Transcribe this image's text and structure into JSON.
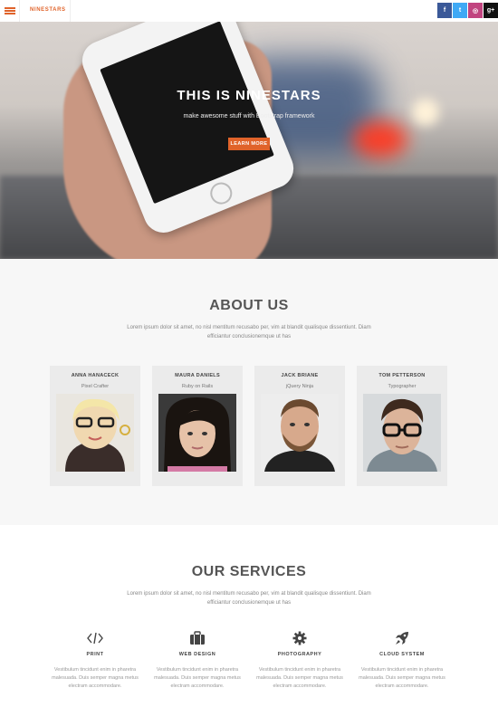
{
  "header": {
    "brand": "NINESTARS",
    "social": [
      {
        "icon": "facebook-icon",
        "label": "f",
        "color": "#3b5998"
      },
      {
        "icon": "twitter-icon",
        "label": "t",
        "color": "#3fa9f5"
      },
      {
        "icon": "instagram-icon",
        "label": "◎",
        "color": "#c1447f"
      },
      {
        "icon": "google-plus-icon",
        "label": "g+",
        "color": "#111111"
      }
    ]
  },
  "hero": {
    "title": "THIS IS NINESTARS",
    "subtitle": "make awesome stuff with Bootstrap framework",
    "button": "LEARN MORE"
  },
  "about": {
    "title": "ABOUT US",
    "text": "Lorem ipsum dolor sit amet, no nisl mentitum recusabo per, vim at blandit qualisque dissentiunt. Diam efficiantur conclusionemque ut has",
    "team": [
      {
        "name": "ANNA HANACECK",
        "role": "Pixel Crafter"
      },
      {
        "name": "MAURA DANIELS",
        "role": "Ruby on Rails"
      },
      {
        "name": "JACK BRIANE",
        "role": "jQuery Ninja"
      },
      {
        "name": "TOM PETTERSON",
        "role": "Typographer"
      }
    ]
  },
  "services": {
    "title": "OUR SERVICES",
    "text": "Lorem ipsum dolor sit amet, no nisl mentitum recusabo per, vim at blandit qualisque dissentiunt. Diam efficiantur conclusionemque ut has",
    "items": [
      {
        "icon": "code-icon",
        "title": "PRINT",
        "desc": "Vestibulum tincidunt enim in pharetra malesuada. Duis semper magna metus electram accommodare."
      },
      {
        "icon": "briefcase-icon",
        "title": "WEB DESIGN",
        "desc": "Vestibulum tincidunt enim in pharetra malesuada. Duis semper magna metus electram accommodare."
      },
      {
        "icon": "gear-icon",
        "title": "PHOTOGRAPHY",
        "desc": "Vestibulum tincidunt enim in pharetra malesuada. Duis semper magna metus electram accommodare."
      },
      {
        "icon": "rocket-icon",
        "title": "CLOUD SYSTEM",
        "desc": "Vestibulum tincidunt enim in pharetra malesuada. Duis semper magna metus electram accommodare."
      }
    ]
  },
  "colors": {
    "accent": "#e0632a"
  }
}
